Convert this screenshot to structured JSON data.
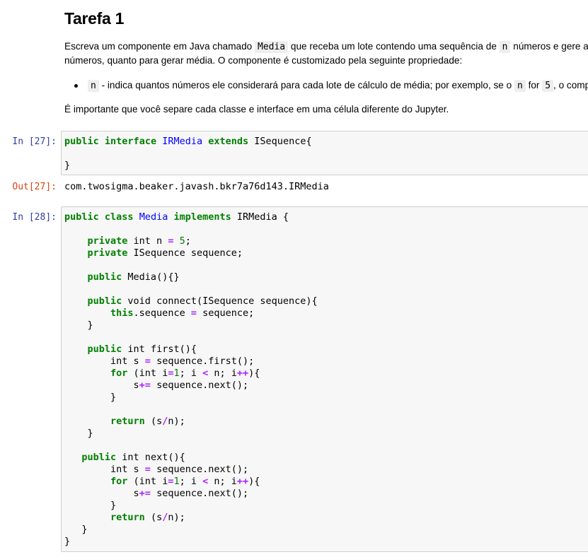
{
  "markdown": {
    "title": "Tarefa 1",
    "para1": {
      "t1": "Escreva um componente em Java chamado ",
      "code1": "Media",
      "t2": " que receba um lote contendo uma sequência de ",
      "code2": "n",
      "t3": " números e gere a",
      "line2": "números, quanto para gerar média. O componente é customizado pela seguinte propriedade:"
    },
    "bullet": {
      "code1": "n",
      "t1": " - indica quantos números ele considerará para cada lote de cálculo de média; por exemplo, se o ",
      "code2": "n",
      "t2": " for ",
      "code3": "5",
      "t3": ", o comp"
    },
    "para2": "É importante que você separe cada classe e interface em uma célula diferente do Jupyter."
  },
  "cells": {
    "cell27": {
      "in_prompt": "In [27]:",
      "out_prompt": "Out[27]:",
      "output": "com.twosigma.beaker.javash.bkr7a76d143.IRMedia"
    },
    "cell28": {
      "in_prompt": "In [28]:"
    }
  },
  "colors": {
    "keyword": "#008000",
    "classname": "#0000ff",
    "operator": "#aa22ff",
    "in_prompt": "#303f9f",
    "out_prompt": "#d84315",
    "cell_bg": "#f7f7f7"
  }
}
